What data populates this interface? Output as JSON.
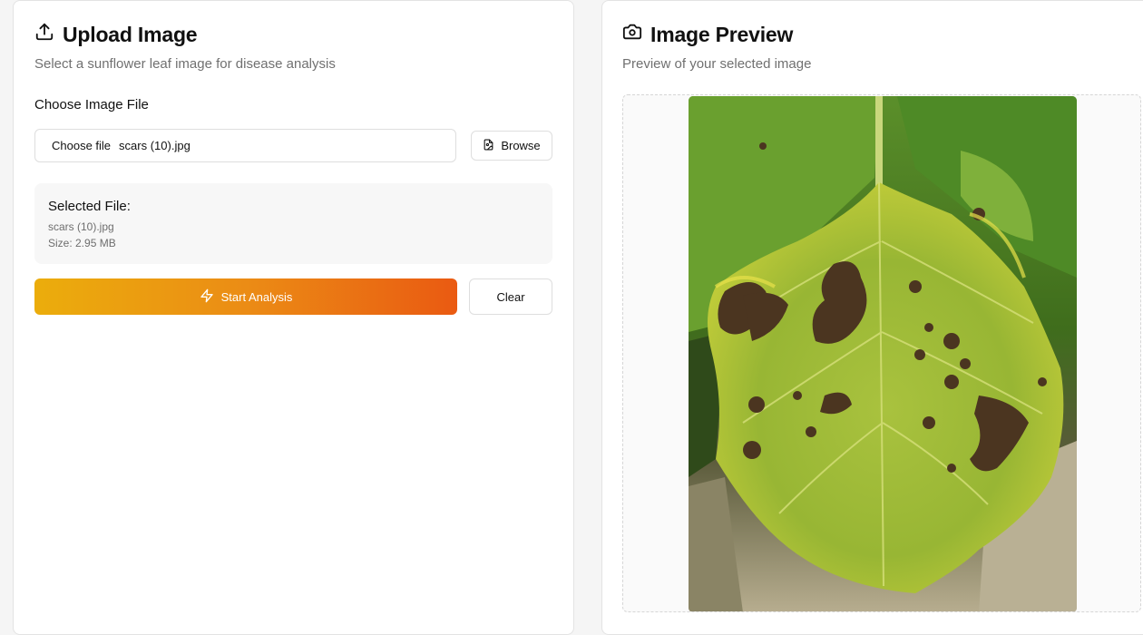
{
  "upload_card": {
    "title": "Upload Image",
    "title_icon": "upload-icon",
    "description": "Select a sunflower leaf image for disease analysis",
    "file_label": "Choose Image File",
    "file_input": {
      "choose_label": "Choose file",
      "value": "scars (10).jpg"
    },
    "browse_button": {
      "label": "Browse",
      "icon": "file-image-icon"
    },
    "selected_file": {
      "heading": "Selected File:",
      "name": "scars (10).jpg",
      "size": "Size: 2.95 MB"
    },
    "analyze_button": {
      "label": "Start Analysis",
      "icon": "zap-icon"
    },
    "clear_button": {
      "label": "Clear"
    }
  },
  "preview_card": {
    "title": "Image Preview",
    "title_icon": "camera-icon",
    "description": "Preview of your selected image",
    "image_subject": "sunflower-leaf-photo"
  },
  "colors": {
    "accent_start": "#ebad0c",
    "accent_end": "#ea5a12"
  }
}
